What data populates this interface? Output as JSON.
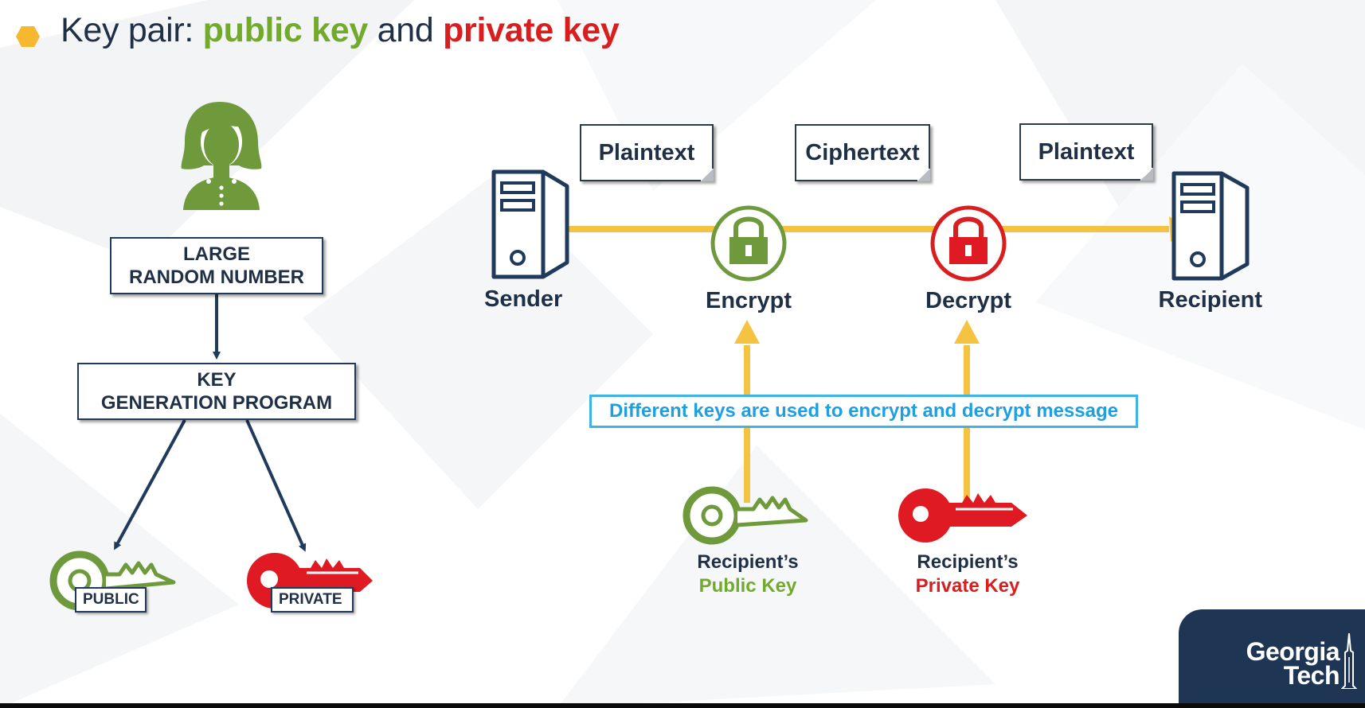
{
  "title": {
    "prefix": "Key pair: ",
    "public": "public key",
    "middle": " and ",
    "private": "private key"
  },
  "keygen": {
    "box1_line1": "LARGE",
    "box1_line2": "RANDOM NUMBER",
    "box2_line1": "KEY",
    "box2_line2": "GENERATION PROGRAM",
    "public_tag": "PUBLIC",
    "private_tag": "PRIVATE"
  },
  "flow": {
    "notes": [
      "Plaintext",
      "Ciphertext",
      "Plaintext"
    ],
    "sender": "Sender",
    "encrypt": "Encrypt",
    "decrypt": "Decrypt",
    "recipient": "Recipient",
    "callout": "Different keys are used to encrypt and decrypt message",
    "public_key_owner": "Recipient’s",
    "public_key_name": "Public Key",
    "private_key_owner": "Recipient’s",
    "private_key_name": "Private Key"
  },
  "logo": {
    "line1": "Georgia",
    "line2": "Tech"
  },
  "colors": {
    "navy": "#1f3046",
    "green": "#72aa2c",
    "red": "#d81e1e",
    "amber": "#f5c342",
    "cyan": "#3fb2e6",
    "key_green": "#6e9a3c",
    "key_red": "#e01a22"
  }
}
